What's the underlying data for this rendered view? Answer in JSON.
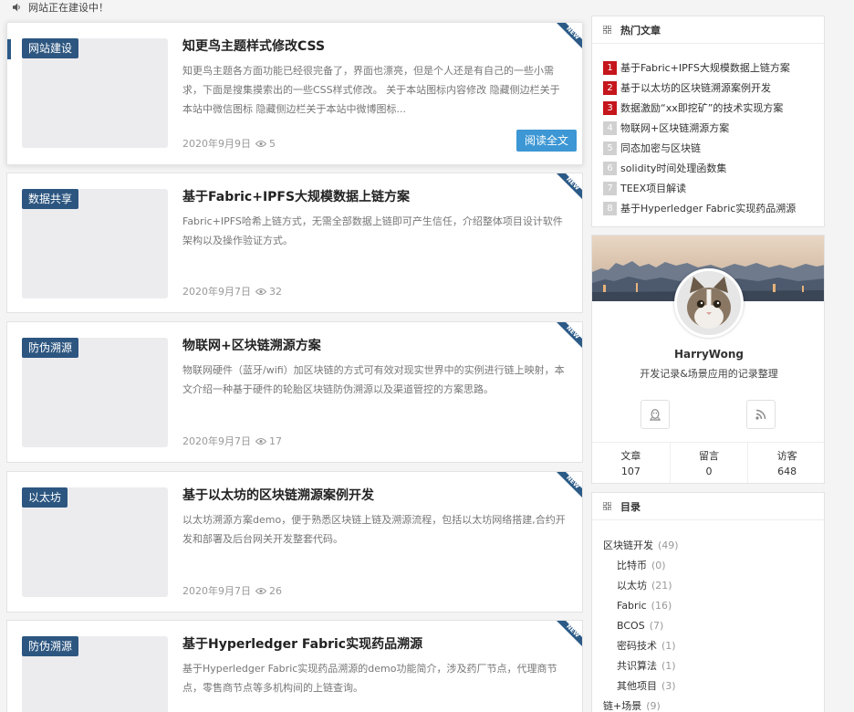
{
  "notice": {
    "text": "网站正在建设中！"
  },
  "posts": [
    {
      "category": "网站建设",
      "title": "知更鸟主题样式修改CSS",
      "excerpt": "知更鸟主题各方面功能已经很完备了，界面也漂亮，但是个人还是有自己的一些小需求，下面是搜集摸索出的一些CSS样式修改。 关于本站图标内容修改 隐藏侧边栏关于本站中微信图标 隐藏侧边栏关于本站中微博图标...",
      "date": "2020年9月9日",
      "views": "5",
      "badge": "NEW",
      "readmore": "阅读全文"
    },
    {
      "category": "数据共享",
      "title": "基于Fabric+IPFS大规模数据上链方案",
      "excerpt": "Fabric+IPFS哈希上链方式，无需全部数据上链即可产生信任，介绍整体项目设计软件架构以及操作验证方式。",
      "date": "2020年9月7日",
      "views": "32",
      "badge": "NEW"
    },
    {
      "category": "防伪溯源",
      "title": "物联网+区块链溯源方案",
      "excerpt": "物联网硬件（蓝牙/wifi）加区块链的方式可有效对现实世界中的实例进行链上映射，本文介绍一种基于硬件的轮胎区块链防伪溯源以及渠道管控的方案思路。",
      "date": "2020年9月7日",
      "views": "17",
      "badge": "NEW"
    },
    {
      "category": "以太坊",
      "title": "基于以太坊的区块链溯源案例开发",
      "excerpt": "以太坊溯源方案demo，便于熟悉区块链上链及溯源流程，包括以太坊网络搭建,合约开发和部署及后台网关开发整套代码。",
      "date": "2020年9月7日",
      "views": "26",
      "badge": "NEW"
    },
    {
      "category": "防伪溯源",
      "title": "基于Hyperledger Fabric实现药品溯源",
      "excerpt": "基于Hyperledger Fabric实现药品溯源的demo功能简介，涉及药厂节点，代理商节点，零售商节点等多机构间的上链查询。",
      "badge": "NEW"
    }
  ],
  "hot": {
    "title": "热门文章",
    "items": [
      {
        "num": "1",
        "text": "基于Fabric+IPFS大规模数据上链方案"
      },
      {
        "num": "2",
        "text": "基于以太坊的区块链溯源案例开发"
      },
      {
        "num": "3",
        "text": "数据激励“xx即挖矿”的技术实现方案"
      },
      {
        "num": "4",
        "text": "物联网+区块链溯源方案"
      },
      {
        "num": "5",
        "text": "同态加密与区块链"
      },
      {
        "num": "6",
        "text": "solidity时间处理函数集"
      },
      {
        "num": "7",
        "text": "TEEX项目解读"
      },
      {
        "num": "8",
        "text": "基于Hyperledger Fabric实现药品溯源"
      }
    ]
  },
  "profile": {
    "name": "HarryWong",
    "desc": "开发记录&场景应用的记录整理",
    "stats": [
      {
        "label": "文章",
        "value": "107"
      },
      {
        "label": "留言",
        "value": "0"
      },
      {
        "label": "访客",
        "value": "648"
      }
    ]
  },
  "catalog": {
    "title": "目录",
    "items": [
      {
        "name": "区块链开发",
        "count": "(49)",
        "sub": false
      },
      {
        "name": "比特币",
        "count": "(0)",
        "sub": true
      },
      {
        "name": "以太坊",
        "count": "(21)",
        "sub": true
      },
      {
        "name": "Fabric",
        "count": "(16)",
        "sub": true
      },
      {
        "name": "BCOS",
        "count": "(7)",
        "sub": true
      },
      {
        "name": "密码技术",
        "count": "(1)",
        "sub": true
      },
      {
        "name": "共识算法",
        "count": "(1)",
        "sub": true
      },
      {
        "name": "其他项目",
        "count": "(3)",
        "sub": true
      },
      {
        "name": "链+场景",
        "count": "(9)",
        "sub": false
      }
    ]
  },
  "colors": {
    "category_bg": "#2c5680",
    "readmore_bg": "#3d97d4",
    "hot_top_bg": "#c4161c",
    "hot_other_bg": "#d0d0d0"
  }
}
